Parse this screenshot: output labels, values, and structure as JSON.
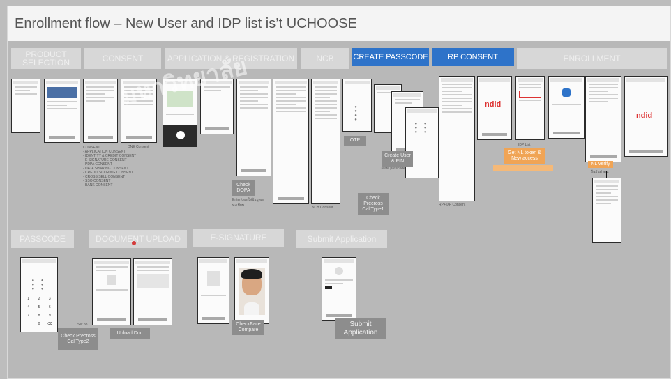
{
  "title": "Enrollment flow – New User and IDP list is’t UCHOOSE",
  "stages_top": [
    {
      "label": "PRODUCT SELECTION"
    },
    {
      "label": "CONSENT"
    },
    {
      "label": "APPLICATION & REGISTRATION"
    },
    {
      "label": "NCB"
    },
    {
      "label": "CREATE PASSCODE"
    },
    {
      "label": "RP CONSENT"
    },
    {
      "label": "ENROLLMENT"
    }
  ],
  "stages_bottom": [
    {
      "label": "PASSCODE"
    },
    {
      "label": "DOCUMENT UPLOAD"
    },
    {
      "label": "E-SIGNATURE"
    },
    {
      "label": "Submit Application"
    }
  ],
  "notes": {
    "consent_list": "CONSENT\n- APPLICATION CONSENT\n- IDENTITY & CREDIT CONSENT\n- E-SIGNATURE CONSENT\n- PDPA CONSENT\n- DATA SHARING CONSENT\n- CREDIT SCORING CONSENT\n- CROSS SELL CONSENT\n- SSO CONSENT\n- BANK CONSENT",
    "dne_consent": "DNE Consent",
    "check_dopa_caption": "Enter/ownใส่ข้อมูลลงทะเบียน",
    "ncb_consent": "NCB Consent",
    "create_passcode": "Create passcode",
    "rp_idp_consent": "RP+IDP Consent",
    "idp_list": "IDP List",
    "set_no": "Set no.",
    "nl_caption": "ยืนยันตัวตน"
  },
  "tags": {
    "check_dopa": "Check DOPA",
    "otp": "OTP",
    "check_precross": "Check Precross CallType1",
    "create_user_pin": "Create User & PIN",
    "get_nl_token": "Get NL token & New access",
    "nl_verify": "NL verify",
    "check_precross2": "Check Precross CallType2",
    "upload_doc": "Upload Doc",
    "check_face": "CheckFace Compare",
    "submit_application": "Submit Application"
  },
  "logos": {
    "ndid": "ndid"
  },
  "watermark": "มหาวิทยาลัย"
}
